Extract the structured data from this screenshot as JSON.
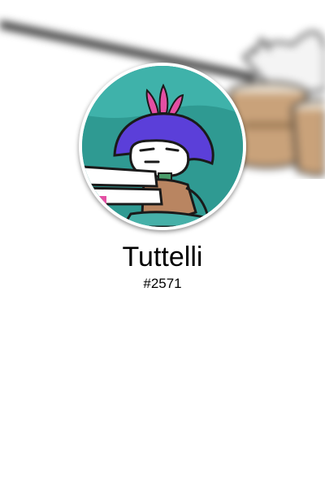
{
  "profile": {
    "username": "Tuttelli",
    "discriminator": "#2571"
  },
  "avatar": {
    "icon": "cartoon-character-avatar",
    "ring_color": "#ffffff",
    "background_color": "#2f9a92"
  },
  "banner": {
    "icon": "blurred-drum-cat-banner"
  }
}
